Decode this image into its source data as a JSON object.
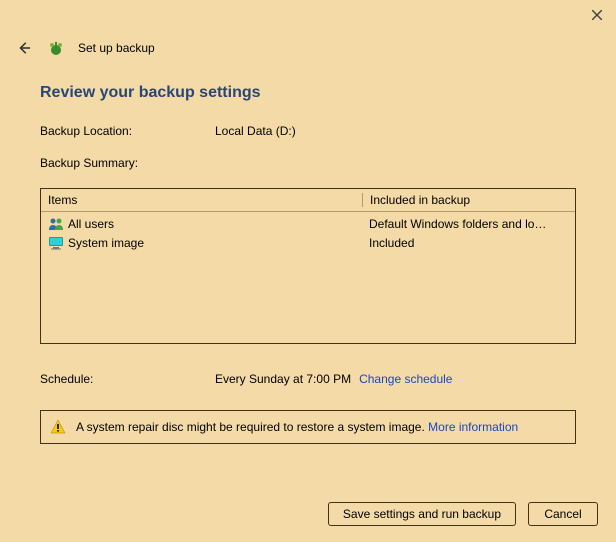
{
  "window": {
    "title": "Set up backup"
  },
  "heading": "Review your backup settings",
  "location": {
    "label": "Backup Location:",
    "value": "Local Data (D:)"
  },
  "summary": {
    "label": "Backup Summary:",
    "headers": {
      "items": "Items",
      "included": "Included in backup"
    },
    "rows": [
      {
        "label": "All users",
        "included": "Default Windows folders and lo…"
      },
      {
        "label": "System image",
        "included": "Included"
      }
    ]
  },
  "schedule": {
    "label": "Schedule:",
    "value": "Every Sunday at 7:00 PM",
    "change_link": "Change schedule"
  },
  "warning": {
    "text": "A system repair disc might be required to restore a system image. ",
    "link": "More information"
  },
  "buttons": {
    "save": "Save settings and run backup",
    "cancel": "Cancel"
  }
}
